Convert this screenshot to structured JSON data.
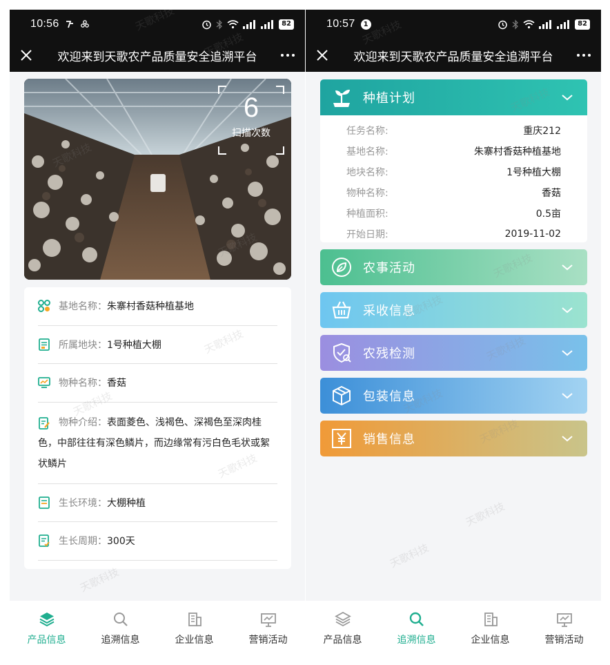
{
  "watermark_text": "天歌科技",
  "left_screen": {
    "status": {
      "time": "10:56",
      "battery": "82"
    },
    "nav": {
      "title": "欢迎来到天歌农产品质量安全追溯平台"
    },
    "hero": {
      "scan_count": "6",
      "scan_label": "扫描次数"
    },
    "info": [
      {
        "label": "基地名称：",
        "value": "朱寨村香菇种植基地",
        "icon": "grid-icon",
        "color": "#f5a623"
      },
      {
        "label": "所属地块：",
        "value": "1号种植大棚",
        "icon": "plot-icon",
        "color": "#1fae8f"
      },
      {
        "label": "物种名称：",
        "value": "香菇",
        "icon": "species-icon",
        "color": "#1fae8f"
      },
      {
        "label": "物种介绍：",
        "value": "表面菱色、浅褐色、深褐色至深肉桂色，中部往往有深色鳞片，而边缘常有污白色毛状或絮状鳞片",
        "icon": "intro-icon",
        "color": "#1fae8f"
      },
      {
        "label": "生长环境：",
        "value": "大棚种植",
        "icon": "environment-icon",
        "color": "#1fae8f"
      },
      {
        "label": "生长周期：",
        "value": "300天",
        "icon": "cycle-icon",
        "color": "#1fae8f"
      }
    ],
    "tabs": [
      {
        "label": "产品信息",
        "active": true
      },
      {
        "label": "追溯信息",
        "active": false
      },
      {
        "label": "企业信息",
        "active": false
      },
      {
        "label": "营销活动",
        "active": false
      }
    ]
  },
  "right_screen": {
    "status": {
      "time": "10:57",
      "notif": "1",
      "battery": "82"
    },
    "nav": {
      "title": "欢迎来到天歌农产品质量安全追溯平台"
    },
    "plan": {
      "title": "种植计划",
      "rows": [
        {
          "label": "任务名称:",
          "value": "重庆212"
        },
        {
          "label": "基地名称:",
          "value": "朱寨村香菇种植基地"
        },
        {
          "label": "地块名称:",
          "value": "1号种植大棚"
        },
        {
          "label": "物种名称:",
          "value": "香菇"
        },
        {
          "label": "种植面积:",
          "value": "0.5亩"
        },
        {
          "label": "开始日期:",
          "value": "2019-11-02"
        }
      ]
    },
    "sections": {
      "farm": "农事活动",
      "harvest": "采收信息",
      "pest": "农残检测",
      "pack": "包装信息",
      "sale": "销售信息"
    },
    "tabs": [
      {
        "label": "产品信息",
        "active": false
      },
      {
        "label": "追溯信息",
        "active": true
      },
      {
        "label": "企业信息",
        "active": false
      },
      {
        "label": "营销活动",
        "active": false
      }
    ]
  },
  "colors": {
    "accent": "#1fae8f",
    "bar": "#111111"
  }
}
